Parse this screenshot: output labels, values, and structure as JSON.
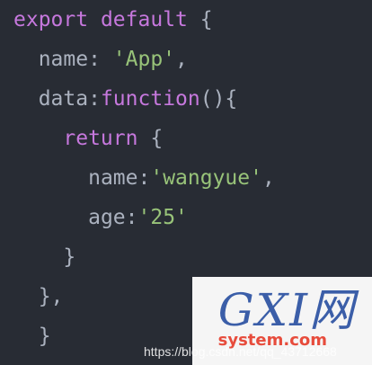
{
  "code": {
    "lines": [
      {
        "indent": "",
        "parts": [
          {
            "t": "kw",
            "v": "export"
          },
          {
            "t": "punc",
            "v": " "
          },
          {
            "t": "kw",
            "v": "default"
          },
          {
            "t": "punc",
            "v": " {"
          }
        ]
      },
      {
        "indent": "  ",
        "parts": [
          {
            "t": "prop",
            "v": "name"
          },
          {
            "t": "punc",
            "v": ": "
          },
          {
            "t": "str",
            "v": "'App'"
          },
          {
            "t": "punc",
            "v": ","
          }
        ]
      },
      {
        "indent": "  ",
        "parts": [
          {
            "t": "prop",
            "v": "data"
          },
          {
            "t": "punc",
            "v": ":"
          },
          {
            "t": "fn",
            "v": "function"
          },
          {
            "t": "punc",
            "v": "(){"
          }
        ]
      },
      {
        "indent": "    ",
        "parts": [
          {
            "t": "kw",
            "v": "return"
          },
          {
            "t": "punc",
            "v": " {"
          }
        ]
      },
      {
        "indent": "      ",
        "parts": [
          {
            "t": "prop",
            "v": "name"
          },
          {
            "t": "punc",
            "v": ":"
          },
          {
            "t": "str",
            "v": "'wangyue'"
          },
          {
            "t": "punc",
            "v": ","
          }
        ]
      },
      {
        "indent": "      ",
        "parts": [
          {
            "t": "prop",
            "v": "age"
          },
          {
            "t": "punc",
            "v": ":"
          },
          {
            "t": "str",
            "v": "'25'"
          }
        ]
      },
      {
        "indent": "    ",
        "parts": [
          {
            "t": "punc",
            "v": "}"
          }
        ]
      },
      {
        "indent": "  ",
        "parts": [
          {
            "t": "punc",
            "v": "},"
          }
        ]
      },
      {
        "indent": "  ",
        "parts": [
          {
            "t": "punc",
            "v": "}"
          }
        ]
      }
    ]
  },
  "watermark": {
    "logo": "GXI网",
    "site": "system.com",
    "url": "https://blog.csdn.net/qq_43712668"
  },
  "colors": {
    "background": "#282c34",
    "keyword": "#c678dd",
    "string": "#98c379",
    "default": "#abb2bf"
  }
}
